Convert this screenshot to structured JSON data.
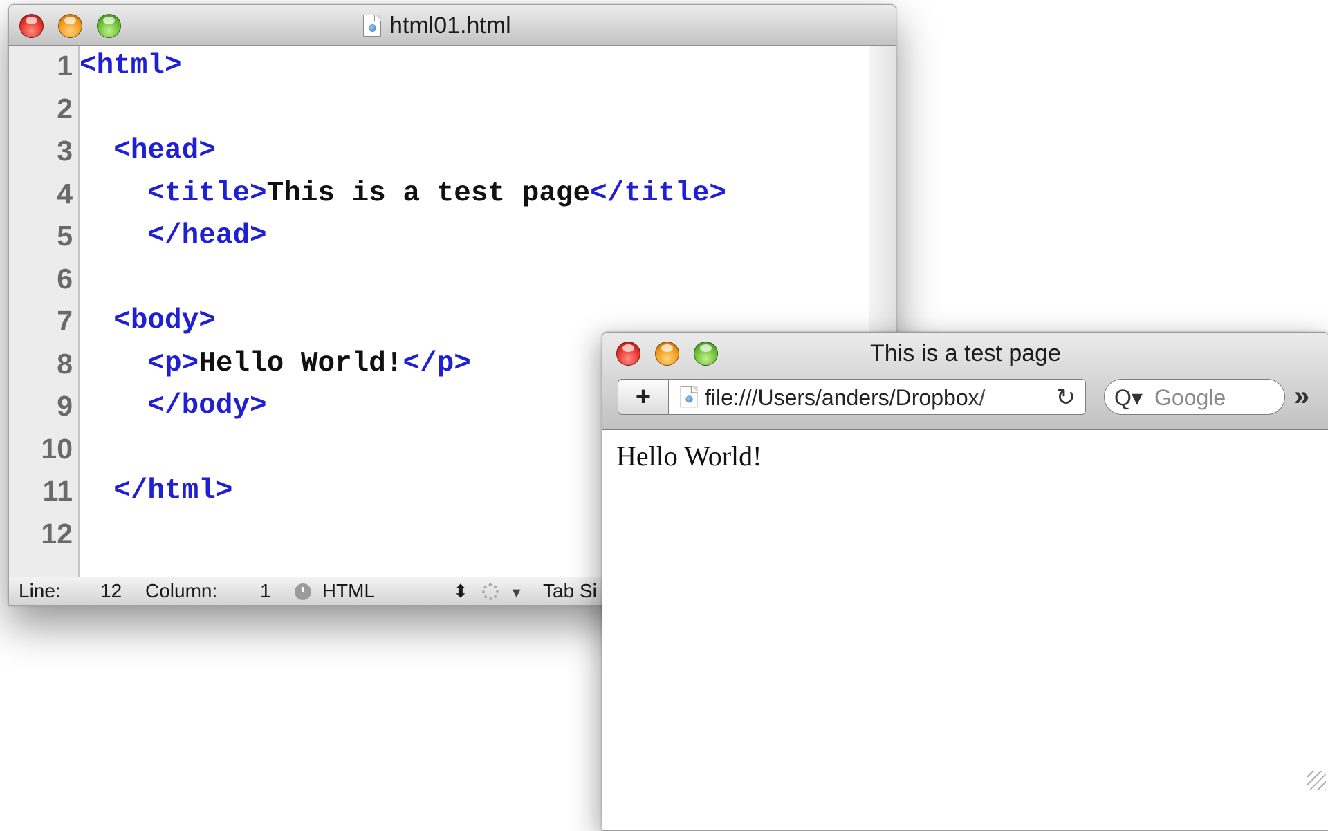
{
  "editor": {
    "title": "html01.html",
    "line_numbers": [
      "1",
      "2",
      "3",
      "4",
      "5",
      "6",
      "7",
      "8",
      "9",
      "10",
      "11",
      "12"
    ],
    "lines": [
      [
        {
          "t": "tag",
          "v": "<html>"
        }
      ],
      [],
      [
        {
          "t": "txt",
          "v": "  "
        },
        {
          "t": "tag",
          "v": "<head>"
        }
      ],
      [
        {
          "t": "txt",
          "v": "    "
        },
        {
          "t": "tag",
          "v": "<title>"
        },
        {
          "t": "txt",
          "v": "This is a test page"
        },
        {
          "t": "tag",
          "v": "</title>"
        }
      ],
      [
        {
          "t": "txt",
          "v": "    "
        },
        {
          "t": "tag",
          "v": "</head>"
        }
      ],
      [],
      [
        {
          "t": "txt",
          "v": "  "
        },
        {
          "t": "tag",
          "v": "<body>"
        }
      ],
      [
        {
          "t": "txt",
          "v": "    "
        },
        {
          "t": "tag",
          "v": "<p>"
        },
        {
          "t": "txt",
          "v": "Hello World!"
        },
        {
          "t": "tag",
          "v": "</p>"
        }
      ],
      [
        {
          "t": "txt",
          "v": "    "
        },
        {
          "t": "tag",
          "v": "</body>"
        }
      ],
      [],
      [
        {
          "t": "txt",
          "v": "  "
        },
        {
          "t": "tag",
          "v": "</html>"
        }
      ],
      []
    ],
    "status": {
      "line_label": "Line:",
      "line_value": "12",
      "column_label": "Column:",
      "column_value": "1",
      "language": "HTML",
      "language_arrows": "⬍",
      "tab_size": "Tab Si"
    },
    "colors": {
      "tag": "#1f1fd4",
      "text": "#111111"
    }
  },
  "browser": {
    "title": "This is a test page",
    "add_label": "+",
    "url": "file:///Users/anders/Dropbox/",
    "reload_icon": "↻",
    "search_icon": "Q▾",
    "search_placeholder": "Google",
    "overflow_icon": "»",
    "page_text": "Hello World!"
  }
}
